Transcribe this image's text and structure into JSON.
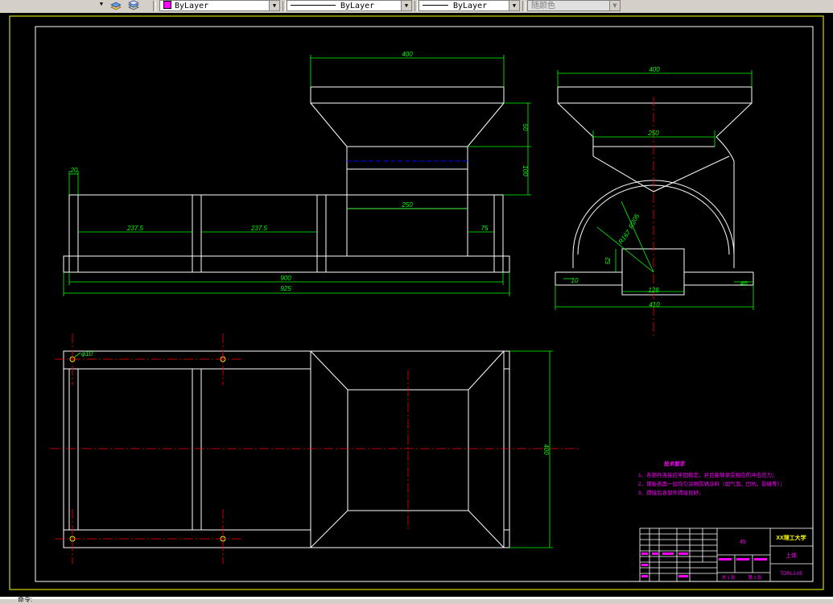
{
  "toolbar": {
    "color_control": "ByLayer",
    "linetype_control": "ByLayer",
    "lineweight_control": "ByLayer",
    "plotstyle_control": "随颜色",
    "colors": {
      "bylayer_swatch": "#ff00ff"
    },
    "icons": [
      "layer-previous-icon",
      "layer-states-icon",
      "dropdown-arrow-icon"
    ]
  },
  "drawing": {
    "colors": {
      "background": "#000000",
      "geometry": "#ffffff",
      "dimension": "#00ff00",
      "centerline": "#ff0000",
      "hidden": "#0000ff",
      "frame": "#ffff00",
      "annotation": "#ff00ff"
    },
    "front_view": {
      "dims": {
        "hopper_top_width": "400",
        "hopper_taper_height": "50",
        "throat_height": "100",
        "throat_width": "250",
        "post_width": "20",
        "span_1": "237.5",
        "span_2": "237.5",
        "end_span": "75",
        "base_inner": "900",
        "base_overall": "925"
      }
    },
    "side_view": {
      "dims": {
        "top_width": "400",
        "mid_width": "250",
        "radius_outer": "R205",
        "radius_inner": "R167",
        "block_height": "52",
        "left_step": "10",
        "right_step": "40",
        "block_width": "128",
        "overall_width": "410"
      }
    },
    "plan_view": {
      "dims": {
        "hole_dia": "φ10",
        "overall_height": "400"
      }
    },
    "tech_notes": {
      "title": "技术要求",
      "lines": [
        "1、各部件连接应牢固稳定，并且能够承受相应的冲击应力；",
        "2、钢板表面一层均匀涂刷防锈涂料（如气泡，凹坑，裂缝等）；",
        "3、焊接后各部件焊接良好。"
      ]
    },
    "title_block": {
      "material": "45",
      "school": "XX理工大学",
      "part_name": "上体",
      "drawing_no": "TDRLJ-05",
      "sheet_total": "共 1 张",
      "sheet_no": "第 1 张"
    }
  },
  "command_line": {
    "text": "命令:"
  }
}
